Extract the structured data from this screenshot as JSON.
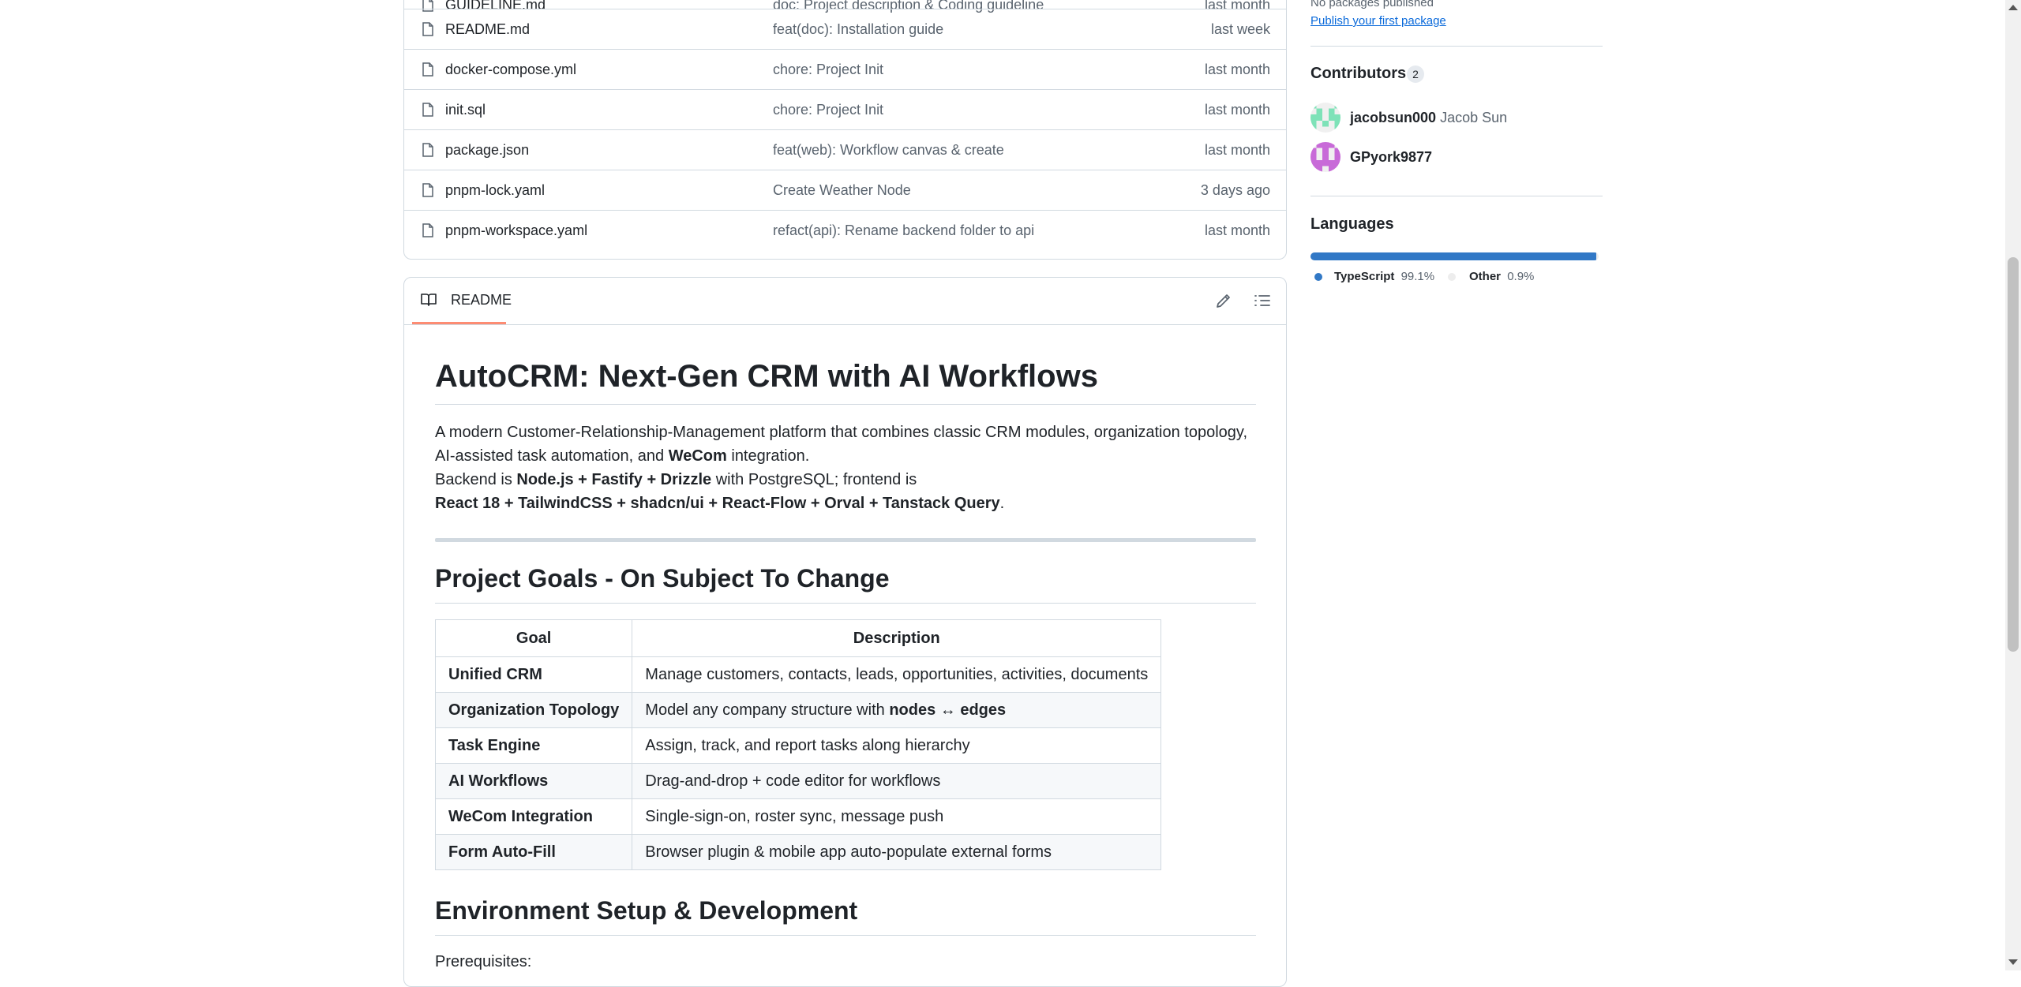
{
  "files": [
    {
      "name": "GUIDELINE.md",
      "message": "doc: Project description & Coding guideline",
      "date": "last month"
    },
    {
      "name": "README.md",
      "message": "feat(doc): Installation guide",
      "date": "last week"
    },
    {
      "name": "docker-compose.yml",
      "message": "chore: Project Init",
      "date": "last month"
    },
    {
      "name": "init.sql",
      "message": "chore: Project Init",
      "date": "last month"
    },
    {
      "name": "package.json",
      "message": "feat(web): Workflow canvas & create",
      "date": "last month"
    },
    {
      "name": "pnpm-lock.yaml",
      "message": "Create Weather Node",
      "date": "3 days ago"
    },
    {
      "name": "pnpm-workspace.yaml",
      "message": "refact(api): Rename backend folder to api",
      "date": "last month"
    }
  ],
  "readme": {
    "tab_label": "README",
    "title": "AutoCRM: Next-Gen CRM with AI Workflows",
    "intro": {
      "line1": "A modern Customer-Relationship-Management platform that combines classic CRM modules, organization topology,",
      "line2_a": "AI-assisted task automation, and ",
      "line2_b": "WeCom",
      "line2_c": " integration.",
      "line3_a": "Backend is ",
      "line3_b": "Node.js + Fastify + Drizzle",
      "line3_c": " with PostgreSQL; frontend is",
      "line4_a": "React 18 + TailwindCSS + shadcn/ui + React-Flow + Orval + Tanstack Query",
      "line4_b": "."
    },
    "goals_heading": "Project Goals - On Subject To Change",
    "goals_table": {
      "headers": [
        "Goal",
        "Description"
      ],
      "rows": [
        {
          "goal": "Unified CRM",
          "desc": "Manage customers, contacts, leads, opportunities, activities, documents"
        },
        {
          "goal": "Organization Topology",
          "desc": "Model any company structure with ",
          "desc_bold": "nodes ↔ edges"
        },
        {
          "goal": "Task Engine",
          "desc": "Assign, track, and report tasks along hierarchy"
        },
        {
          "goal": "AI Workflows",
          "desc": "Drag-and-drop + code editor for workflows"
        },
        {
          "goal": "WeCom Integration",
          "desc": "Single-sign-on, roster sync, message push"
        },
        {
          "goal": "Form Auto-Fill",
          "desc": "Browser plugin & mobile app auto-populate external forms"
        }
      ]
    },
    "env_heading": "Environment Setup & Development",
    "prereq": "Prerequisites:"
  },
  "sidebar": {
    "packages_text": "No packages published",
    "packages_link": "Publish your first package",
    "contributors_title": "Contributors",
    "contributors_count": "2",
    "contributors": [
      {
        "login": "jacobsun000",
        "name": "Jacob Sun",
        "color": "#7ee2b8"
      },
      {
        "login": "GPyork9877",
        "name": "",
        "color": "#c86ad8"
      }
    ],
    "languages_title": "Languages",
    "languages": [
      {
        "name": "TypeScript",
        "percent": "99.1%",
        "value": 99.1,
        "color": "#3178c6"
      },
      {
        "name": "Other",
        "percent": "0.9%",
        "value": 0.9,
        "color": "#ededed"
      }
    ]
  }
}
